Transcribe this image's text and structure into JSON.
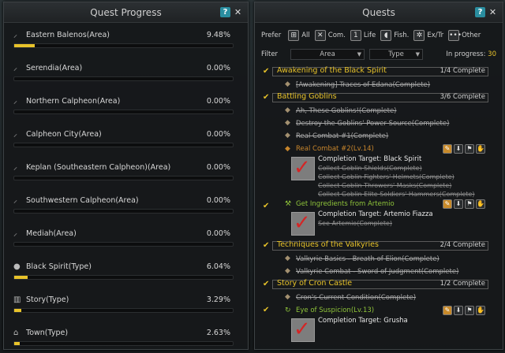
{
  "quest_progress": {
    "title": "Quest Progress",
    "help_label": "?",
    "close_label": "✕",
    "rows": [
      {
        "name": "Eastern Balenos(Area)",
        "percent": "9.48%",
        "fill": 0.0948,
        "icon": "sword-icon"
      },
      {
        "name": "Serendia(Area)",
        "percent": "0.00%",
        "fill": 0,
        "icon": "sword-icon"
      },
      {
        "name": "Northern Calpheon(Area)",
        "percent": "0.00%",
        "fill": 0,
        "icon": "sword-icon"
      },
      {
        "name": "Calpheon City(Area)",
        "percent": "0.00%",
        "fill": 0,
        "icon": "sword-icon"
      },
      {
        "name": "Keplan (Southeastern Calpheon)(Area)",
        "percent": "0.00%",
        "fill": 0,
        "icon": "sword-icon"
      },
      {
        "name": "Southwestern Calpheon(Area)",
        "percent": "0.00%",
        "fill": 0,
        "icon": "sword-icon"
      },
      {
        "name": "Mediah(Area)",
        "percent": "0.00%",
        "fill": 0,
        "icon": "sword-icon"
      },
      {
        "name": "Black Spirit(Type)",
        "percent": "6.04%",
        "fill": 0.0604,
        "icon": "spirit-icon"
      },
      {
        "name": "Story(Type)",
        "percent": "3.29%",
        "fill": 0.0329,
        "icon": "book-icon"
      },
      {
        "name": "Town(Type)",
        "percent": "2.63%",
        "fill": 0.0263,
        "icon": "town-icon"
      }
    ]
  },
  "quests": {
    "title": "Quests",
    "help_label": "?",
    "close_label": "✕",
    "prefer_label": "Prefer",
    "prefs": [
      {
        "label": "All",
        "icon": "grid-icon",
        "glyph": "⊞"
      },
      {
        "label": "Com.",
        "icon": "crossed-swords-icon",
        "glyph": "✕"
      },
      {
        "label": "Life",
        "icon": "life-icon",
        "glyph": "1"
      },
      {
        "label": "Fish.",
        "icon": "fish-icon",
        "glyph": "◖"
      },
      {
        "label": "Ex/Tr",
        "icon": "compass-icon",
        "glyph": "✲"
      },
      {
        "label": "Other",
        "icon": "dots-icon",
        "glyph": "•••"
      }
    ],
    "filter_label": "Filter",
    "area_dropdown": "Area",
    "type_dropdown": "Type",
    "in_progress_label": "In progress:",
    "in_progress_count": "30",
    "groups": [
      {
        "name": "Awakening of the Black Spirit",
        "count": "1/4 Complete",
        "subs": [
          "[Awakening] Traces of Edana(Complete)"
        ]
      },
      {
        "name": "Battling Goblins",
        "count": "3/6 Complete",
        "subs": [
          "Ah, These Goblins!(Complete)",
          "Destroy the Goblins' Power Source(Complete)",
          "Real Combat #1(Complete)"
        ],
        "card": {
          "title": "Real Combat #2(Lv.14)",
          "target": "Completion Target: Black Spirit",
          "lines": [
            "Collect Goblin Shields(Complete)",
            "Collect Goblin Fighters' Helmets(Complete)",
            "Collect Goblin Throwers' Masks(Complete)",
            "Collect Goblin Elite Soldiers' Hammers(Complete)"
          ]
        }
      }
    ],
    "ingredients_card": {
      "title": "Get Ingredients from Artemio",
      "target": "Completion Target: Artemio Fiazza",
      "lines": [
        "See Artemio(Complete)"
      ]
    },
    "groups2": [
      {
        "name": "Techniques of the Valkyries",
        "count": "2/4 Complete",
        "subs": [
          "Valkyrie Basics - Breath of Elion(Complete)",
          "Valkyrie Combat - Sword of Judgment(Complete)"
        ]
      },
      {
        "name": "Story of Cron Castle",
        "count": "1/2 Complete",
        "subs": [
          "Cron's Current Condition(Complete)"
        ]
      }
    ],
    "eye_card": {
      "title": "Eye of Suspicion(Lv.13)",
      "target": "Completion Target: Grusha"
    },
    "colors": {
      "gold": "#e8c32a",
      "orange": "#c8862c",
      "green": "#8fc43a"
    }
  }
}
